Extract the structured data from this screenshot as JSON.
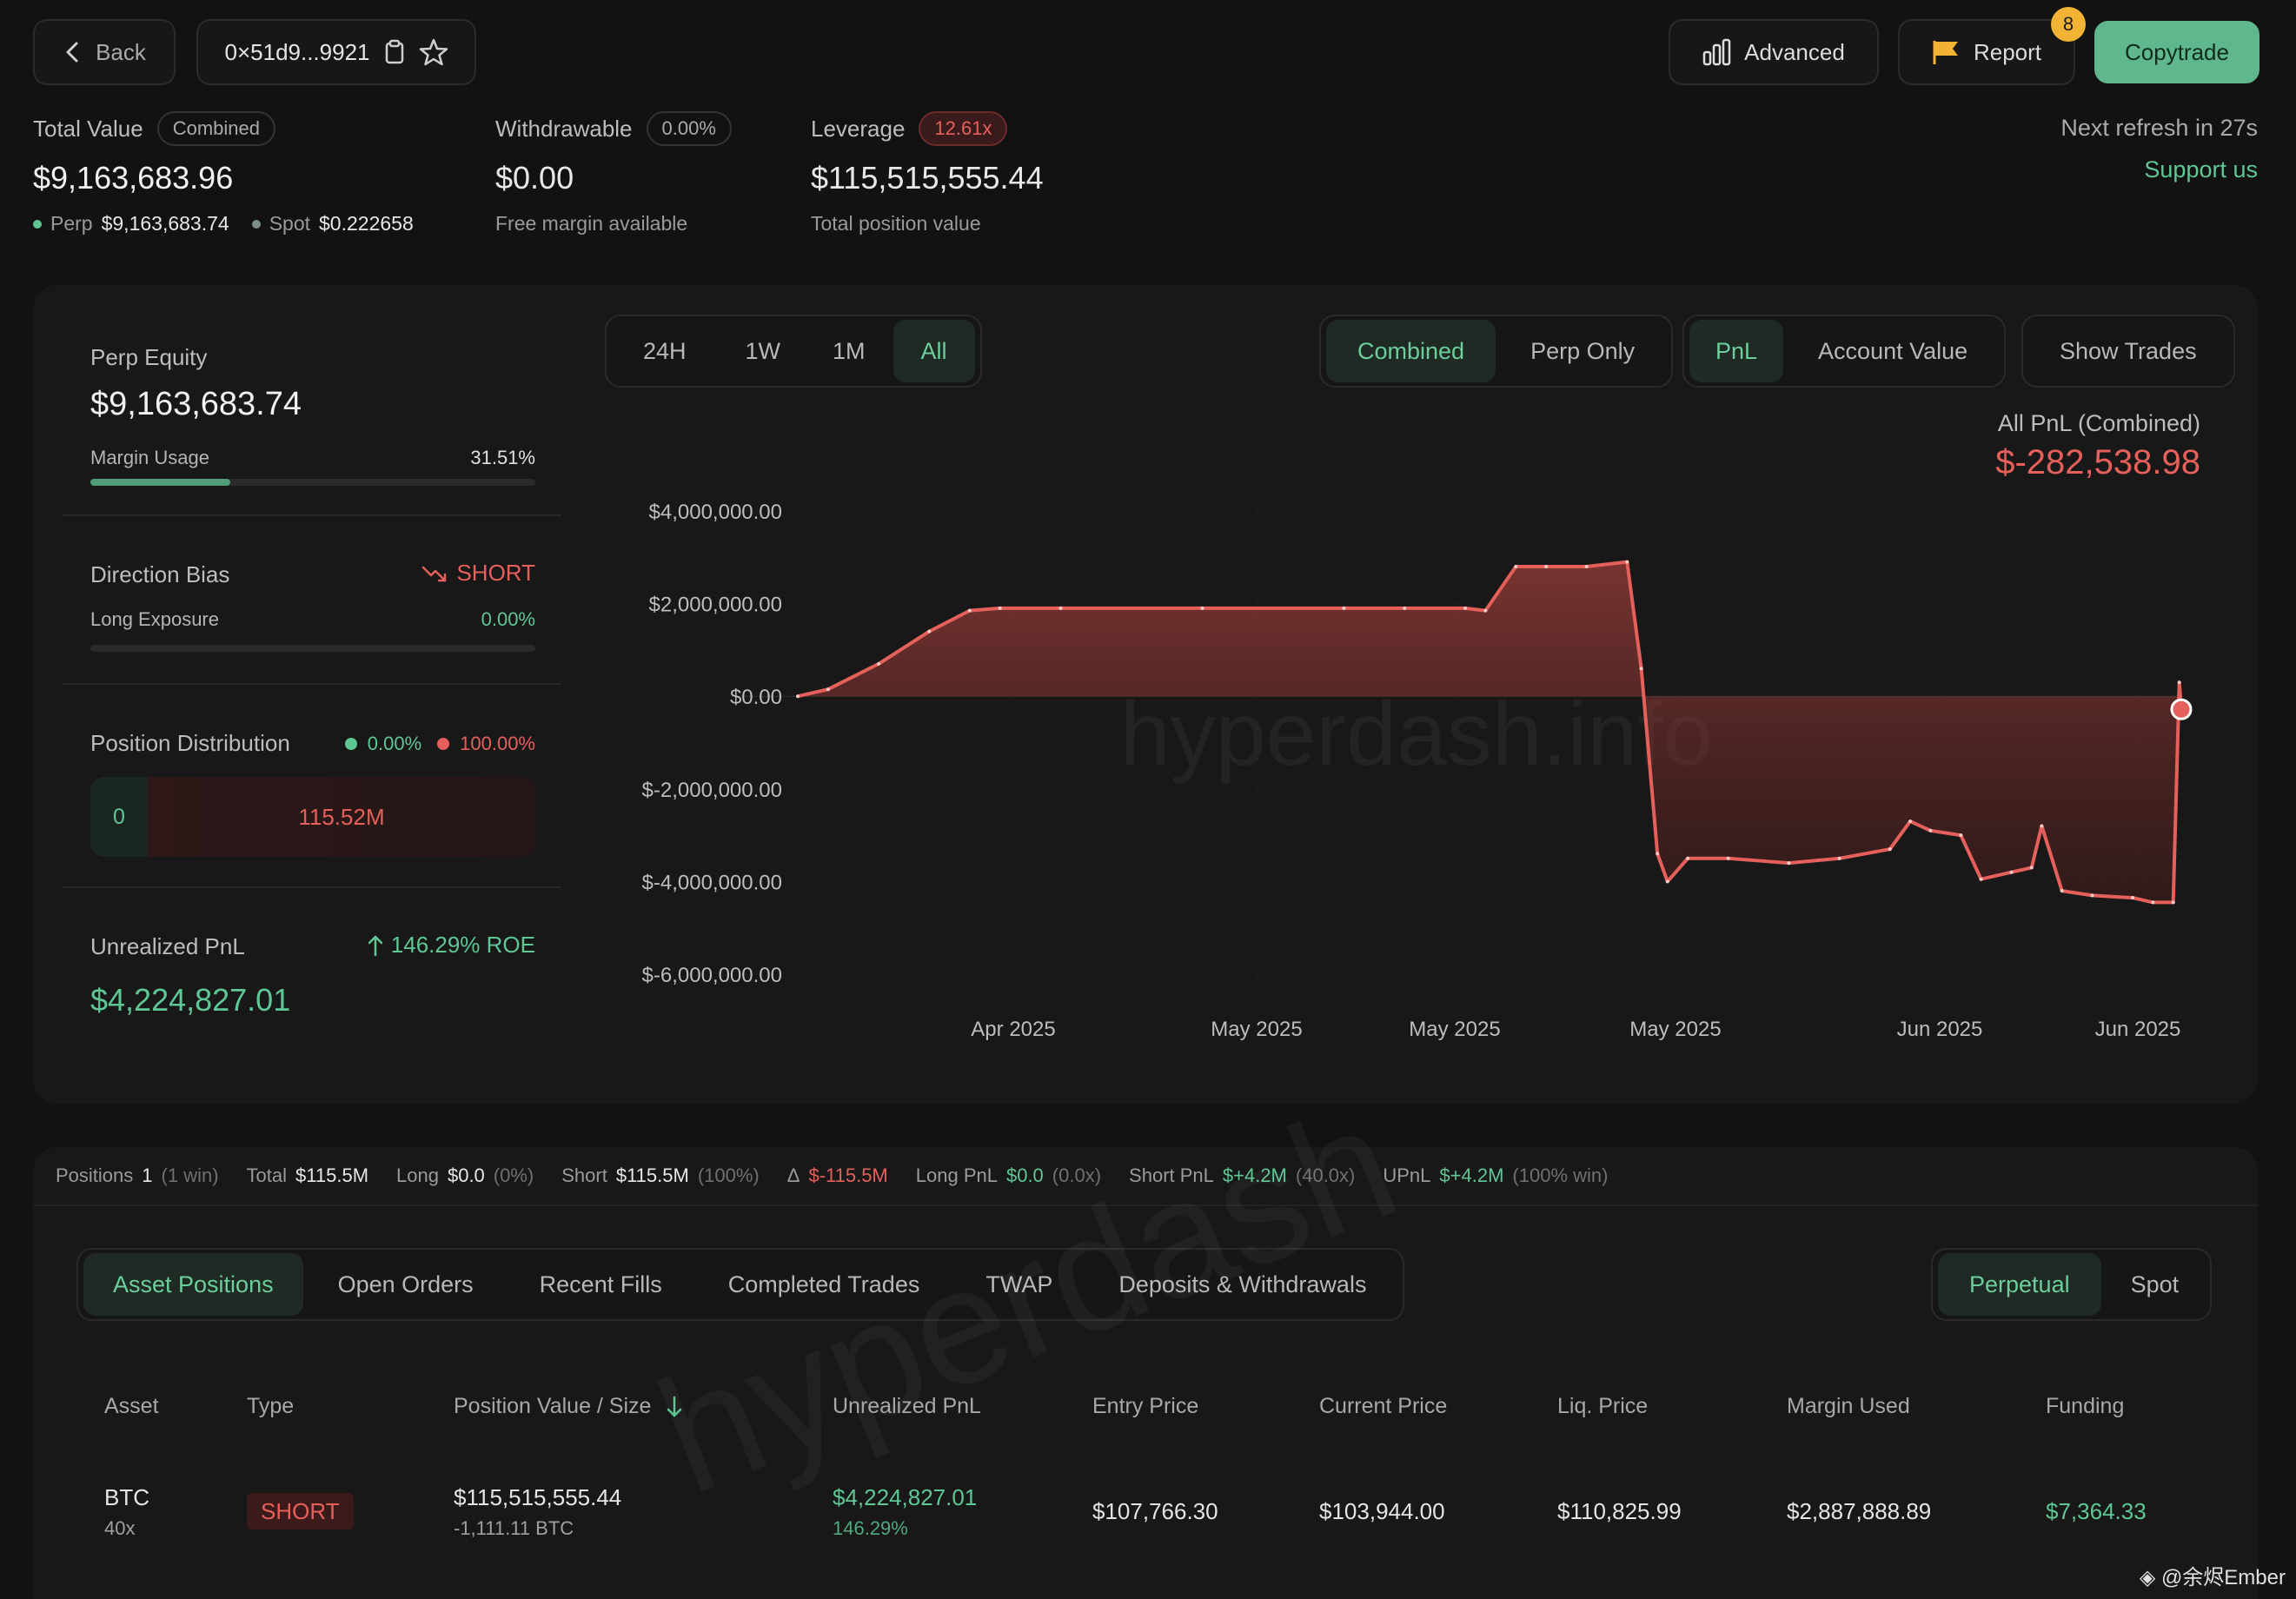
{
  "header": {
    "back_label": "Back",
    "address": "0×51d9...9921",
    "advanced_label": "Advanced",
    "report_label": "Report",
    "report_badge": "8",
    "copytrade_label": "Copytrade"
  },
  "summary": {
    "total_value_label": "Total Value",
    "total_value_pill": "Combined",
    "total_value": "$9,163,683.96",
    "perp_label": "Perp",
    "perp_value": "$9,163,683.74",
    "spot_label": "Spot",
    "spot_value": "$0.222658",
    "withdrawable_label": "Withdrawable",
    "withdrawable_pill": "0.00%",
    "withdrawable_value": "$0.00",
    "withdrawable_sub": "Free margin available",
    "leverage_label": "Leverage",
    "leverage_pill": "12.61x",
    "leverage_value": "$115,515,555.44",
    "leverage_sub": "Total position value",
    "refresh_text": "Next refresh in 27s",
    "support_link": "Support us"
  },
  "left_panel": {
    "perp_equity_label": "Perp Equity",
    "perp_equity_value": "$9,163,683.74",
    "margin_usage_label": "Margin Usage",
    "margin_usage_value": "31.51%",
    "margin_usage_fraction": 0.3151,
    "direction_bias_label": "Direction Bias",
    "direction_bias_value": "SHORT",
    "long_exposure_label": "Long Exposure",
    "long_exposure_value": "0.00%",
    "position_distribution_label": "Position Distribution",
    "dist_long_pct": "0.00%",
    "dist_short_pct": "100.00%",
    "dist_long_value": "0",
    "dist_short_value": "115.52M",
    "unrealized_label": "Unrealized PnL",
    "roe_text": "146.29% ROE",
    "unrealized_value": "$4,224,827.01"
  },
  "chart_controls": {
    "ranges": [
      "24H",
      "1W",
      "1M",
      "All"
    ],
    "active_range": "All",
    "modes": [
      "Combined",
      "Perp Only"
    ],
    "active_mode": "Combined",
    "metrics": [
      "PnL",
      "Account Value"
    ],
    "active_metric": "PnL",
    "show_trades": "Show Trades",
    "pnl_title": "All PnL (Combined)",
    "pnl_value": "$-282,538.98",
    "watermark": "hyperdash.info"
  },
  "chart_data": {
    "type": "area",
    "title": "All PnL (Combined)",
    "yticks": [
      "$4,000,000.00",
      "$2,000,000.00",
      "$0.00",
      "$-2,000,000.00",
      "$-4,000,000.00",
      "$-6,000,000.00"
    ],
    "ylim": [
      -6000000,
      4000000
    ],
    "xticks": [
      "Apr 2025",
      "May 2025",
      "May 2025",
      "May 2025",
      "Jun 2025",
      "Jun 2025"
    ],
    "grid": true,
    "series": [
      {
        "values": [
          0,
          150000,
          700000,
          1400000,
          1850000,
          1900000,
          1900000,
          1900000,
          1900000,
          1900000,
          1900000,
          1850000,
          2800000,
          2800000,
          2800000,
          2900000,
          600000,
          -3400000,
          -4000000,
          -3500000,
          -3500000,
          -3600000,
          -3500000,
          -3300000,
          -2700000,
          -2900000,
          -3000000,
          -3950000,
          -3800000,
          -3700000,
          -2800000,
          -4200000,
          -4300000,
          -4350000,
          -4450000,
          -4450000,
          300000,
          -282538.98
        ]
      }
    ]
  },
  "stats_bar": {
    "positions_label": "Positions",
    "positions_value": "1",
    "positions_sub": "(1 win)",
    "total_label": "Total",
    "total_value": "$115.5M",
    "long_label": "Long",
    "long_value": "$0.0",
    "long_sub": "(0%)",
    "short_label": "Short",
    "short_value": "$115.5M",
    "short_sub": "(100%)",
    "delta_label": "Δ",
    "delta_value": "$-115.5M",
    "longpnl_label": "Long PnL",
    "longpnl_value": "$0.0",
    "longpnl_sub": "(0.0x)",
    "shortpnl_label": "Short PnL",
    "shortpnl_value": "$+4.2M",
    "shortpnl_sub": "(40.0x)",
    "upnl_label": "UPnL",
    "upnl_value": "$+4.2M",
    "upnl_sub": "(100% win)"
  },
  "tabs": {
    "items": [
      "Asset Positions",
      "Open Orders",
      "Recent Fills",
      "Completed Trades",
      "TWAP",
      "Deposits & Withdrawals"
    ],
    "active": "Asset Positions",
    "market_items": [
      "Perpetual",
      "Spot"
    ],
    "market_active": "Perpetual"
  },
  "table": {
    "headers": [
      "Asset",
      "Type",
      "Position Value / Size",
      "Unrealized PnL",
      "Entry Price",
      "Current Price",
      "Liq. Price",
      "Margin Used",
      "Funding"
    ],
    "rows": [
      {
        "asset": "BTC",
        "leverage": "40x",
        "type": "SHORT",
        "position_value": "$115,515,555.44",
        "size": "-1,111.11 BTC",
        "pnl": "$4,224,827.01",
        "pnl_pct": "146.29%",
        "entry": "$107,766.30",
        "current": "$103,944.00",
        "liq": "$110,825.99",
        "margin": "$2,887,888.89",
        "funding": "$7,364.33"
      }
    ],
    "watermark": "hyperdash"
  },
  "footer_watermark": "◈ @余烬Ember",
  "colors": {
    "accent": "#5fc794",
    "negative": "#e5605a",
    "background": "#121212"
  }
}
